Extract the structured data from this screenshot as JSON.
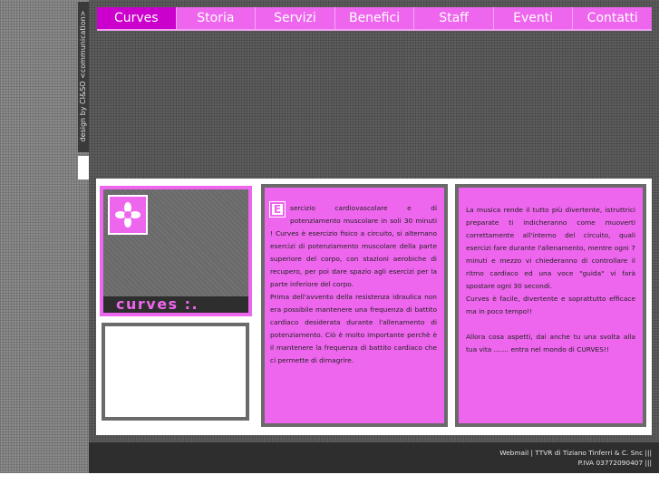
{
  "sidebar": {
    "credit": "design by CI&SO <communication>"
  },
  "nav": {
    "items": [
      {
        "label": "Curves",
        "active": true
      },
      {
        "label": "Storia"
      },
      {
        "label": "Servizi"
      },
      {
        "label": "Benefici"
      },
      {
        "label": "Staff"
      },
      {
        "label": "Eventi"
      },
      {
        "label": "Contatti"
      }
    ]
  },
  "brand": {
    "caption": "curves :.",
    "logo_icon": "flower-icon"
  },
  "column_1": {
    "dropcap": "E",
    "paragraph_1": "sercizio cardiovascolare e di potenziamento muscolare in soli 30 minuti ! Curves è esercizio fisico a circuito, si alternano esercizi di potenziamento muscolare della parte superiore del corpo, con stazioni aerobiche di recupero, per poi dare spazio agli esercizi per la parte inferiore del corpo.",
    "paragraph_2": "Prima dell'avvento della resistenza idraulica non era possibile mantenere una frequenza di battito cardiaco desiderata durante l'allenamento di potenziamento. Ciò è molto importante perchè è il mantenere la frequenza di battito cardiaco che ci permette di dimagrire."
  },
  "column_2": {
    "paragraph_1": "La musica rende il tutto più divertente, istruttrici preparate ti indicheranno come muoverti correttamente all'interno del circuito, quali esercizi fare durante l'allenamento, mentre ogni 7 minuti e mezzo vi chiederanno di controllare il ritmo cardiaco ed una voce \"guida\" vi farà spostare ogni 30 secondi.",
    "paragraph_2": "Curves è facile, divertente e soprattutto efficace ma in poco tempo!!",
    "paragraph_3": "Allora cosa aspetti, dai anche tu una svolta alla tua vita ....... entra nel mondo di CURVES!!"
  },
  "footer": {
    "line_1": "Webmail | TTVR di Tiziano Tinferri & C. Snc |||",
    "line_2": "P.IVA 03772090407 |||"
  },
  "colors": {
    "accent": "#ee66ee",
    "accent_active": "#cc00cc",
    "panel_border": "#6a6a6a",
    "footer_bg": "#2e2e2e"
  }
}
